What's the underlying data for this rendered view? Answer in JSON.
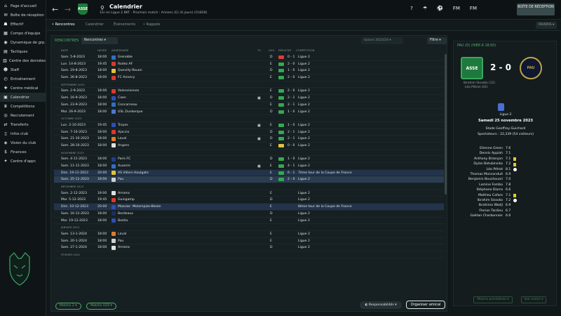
{
  "sidebar": {
    "items": [
      {
        "label": "Page d'accueil",
        "icon": "home-icon",
        "glyph": "⌂"
      },
      {
        "label": "Boîte de réception",
        "icon": "inbox-icon",
        "glyph": "✉"
      },
      {
        "label": "Effectif",
        "icon": "squad-icon",
        "glyph": "☗"
      },
      {
        "label": "Compo d'équipe",
        "icon": "tactics-board-icon",
        "glyph": "▦"
      },
      {
        "label": "Dynamique de grp.",
        "icon": "group-dynamics-icon",
        "glyph": "◉"
      },
      {
        "label": "Tactiques",
        "icon": "tactics-icon",
        "glyph": "▤"
      },
      {
        "label": "Centre des données",
        "icon": "data-icon",
        "glyph": "▥"
      },
      {
        "label": "Staff",
        "icon": "staff-icon",
        "glyph": "☻"
      },
      {
        "label": "Entraînement",
        "icon": "training-icon",
        "glyph": "◴"
      },
      {
        "label": "Centre médical",
        "icon": "medical-icon",
        "glyph": "✚"
      },
      {
        "label": "Calendrier",
        "icon": "calendar-icon",
        "glyph": "▣"
      },
      {
        "label": "Compétitions",
        "icon": "trophy-icon",
        "glyph": "♛"
      },
      {
        "label": "Recrutement",
        "icon": "scouting-icon",
        "glyph": "◎"
      },
      {
        "label": "Transferts",
        "icon": "transfers-icon",
        "glyph": "⇄"
      },
      {
        "label": "Infos club",
        "icon": "club-info-icon",
        "glyph": "▯"
      },
      {
        "label": "Vision du club",
        "icon": "club-vision-icon",
        "glyph": "◈"
      },
      {
        "label": "Finances",
        "icon": "finances-icon",
        "glyph": "$"
      },
      {
        "label": "Centre d'appr.",
        "icon": "academy-icon",
        "glyph": "✦"
      }
    ],
    "active_index": 10
  },
  "topbar": {
    "title": "Calendrier",
    "subtitle": "1er en Ligue 2 BKT · Prochain match : Amiens (E) (4 jours) (Ch828)",
    "badge": "ASSE",
    "icons": [
      "?",
      "☂",
      "⚽",
      "FM",
      "FM"
    ],
    "inbox_label": "BOÎTE DE RÉCEPTION"
  },
  "subtabs": {
    "items": [
      "• Rencontres",
      "Calendrier",
      "Événements",
      "• Rappels"
    ],
    "favorites": "FAVORIS ▾"
  },
  "main": {
    "section_label": "RENCONTRES",
    "dropdown": "Rencontres ▾",
    "season": "Saison 2023/24 ▾",
    "filter": "Filtre ▾",
    "columns": [
      "DATE",
      "HEURE",
      "ADVERSAIRE",
      "TV",
      "LIEU",
      "RÉSULTAT",
      "COMPÉTITION"
    ],
    "rows": [
      {
        "type": "match",
        "date": "Sam. 5-8-2023",
        "time": "18:00",
        "opp": "Grenoble",
        "crest": "#2f6fc4",
        "tv": "",
        "venue": "D",
        "res": "#e23a3a",
        "score": "0 - 1",
        "comp": "Ligue 2"
      },
      {
        "type": "match",
        "date": "Lun. 14-8-2023",
        "time": "19:45",
        "opp": "Rodez AF",
        "crest": "#d9382f",
        "tv": "",
        "venue": "E",
        "res": "#34a853",
        "score": "2 - 0",
        "comp": "Ligue 2"
      },
      {
        "type": "match",
        "date": "Sam. 19-8-2023",
        "time": "18:00",
        "opp": "Quevilly-Rouen",
        "crest": "#e2c23a",
        "tv": "",
        "venue": "D",
        "res": "#34a853",
        "score": "1 - 0",
        "comp": "Ligue 2"
      },
      {
        "type": "match",
        "date": "Sam. 26-8-2023",
        "time": "18:00",
        "opp": "FC Annecy",
        "crest": "#d93a2f",
        "tv": "",
        "venue": "E",
        "res": "#34a853",
        "score": "2 - 0",
        "comp": "Ligue 2"
      },
      {
        "type": "header",
        "label": "SEPTEMBRE 2023"
      },
      {
        "type": "match",
        "date": "Sam. 2-9-2023",
        "time": "18:00",
        "opp": "Valenciennes",
        "crest": "#d93a2f",
        "tv": "",
        "venue": "E",
        "res": "#34a853",
        "score": "2 - 0",
        "comp": "Ligue 2"
      },
      {
        "type": "match",
        "date": "Sam. 16-9-2023",
        "time": "18:00",
        "opp": "Caen",
        "crest": "#2f4fb4",
        "tv": "▣",
        "venue": "D",
        "res": "#34a853",
        "score": "2 - 1",
        "comp": "Ligue 2"
      },
      {
        "type": "match",
        "date": "Sam. 23-9-2023",
        "time": "18:00",
        "opp": "Concarneau",
        "crest": "#2f6fc4",
        "tv": "",
        "venue": "E",
        "res": "#34a853",
        "score": "2 - 1",
        "comp": "Ligue 2"
      },
      {
        "type": "match",
        "date": "Mar. 26-9-2023",
        "time": "18:00",
        "opp": "USL Dunkerque",
        "crest": "#4a7ad0",
        "tv": "",
        "venue": "D",
        "res": "#34a853",
        "score": "1 - 0",
        "comp": "Ligue 2"
      },
      {
        "type": "header",
        "label": "OCTOBRE 2023"
      },
      {
        "type": "match",
        "date": "Lun. 2-10-2023",
        "time": "19:45",
        "opp": "Troyes",
        "crest": "#2f4fb4",
        "tv": "▣",
        "venue": "E",
        "res": "#34a853",
        "score": "1 - 0",
        "comp": "Ligue 2"
      },
      {
        "type": "match",
        "date": "Sam. 7-10-2023",
        "time": "18:00",
        "opp": "Ajaccio",
        "crest": "#d93a2f",
        "tv": "",
        "venue": "D",
        "res": "#34a853",
        "score": "2 - 1",
        "comp": "Ligue 2"
      },
      {
        "type": "match",
        "date": "Sam. 21-10-2023",
        "time": "18:00",
        "opp": "Laval",
        "crest": "#e27a2a",
        "tv": "▣",
        "venue": "D",
        "res": "#34a853",
        "score": "2 - 1",
        "comp": "Ligue 2"
      },
      {
        "type": "match",
        "date": "Sam. 28-10-2023",
        "time": "18:00",
        "opp": "Angers",
        "crest": "#e0e0e0",
        "tv": "",
        "venue": "E",
        "res": "#e2c23a",
        "score": "0 - 0",
        "comp": "Ligue 2"
      },
      {
        "type": "header",
        "label": "NOVEMBRE 2023"
      },
      {
        "type": "match",
        "date": "Sam. 4-11-2023",
        "time": "18:00",
        "opp": "Paris FC",
        "crest": "#1f3f8a",
        "tv": "",
        "venue": "D",
        "res": "#34a853",
        "score": "1 - 0",
        "comp": "Ligue 2"
      },
      {
        "type": "match",
        "date": "Sam. 11-11-2023",
        "time": "18:00",
        "opp": "Auxerre",
        "crest": "#2f6fc4",
        "tv": "▣",
        "venue": "E",
        "res": "#34a853",
        "score": "4 - 1",
        "comp": "Ligue 2"
      },
      {
        "type": "match",
        "date": "Dim. 19-11-2023",
        "time": "20:00",
        "opp": "AS Villers Houlgate",
        "crest": "#e2c23a",
        "tv": "",
        "venue": "E",
        "res": "#34a853",
        "score": "6 - 1",
        "comp": "7ème tour de la Coupe de France",
        "sel": "sel2"
      },
      {
        "type": "match",
        "date": "Sam. 25-11-2023",
        "time": "18:00",
        "opp": "Pau",
        "crest": "#d0d0d0",
        "tv": "",
        "venue": "D",
        "res": "#34a853",
        "score": "2 - 0",
        "comp": "Ligue 2",
        "sel": "sel"
      },
      {
        "type": "header",
        "label": "DÉCEMBRE 2023"
      },
      {
        "type": "match",
        "date": "Sam. 2-12-2023",
        "time": "18:00",
        "opp": "Amiens",
        "crest": "#e0e0e0",
        "tv": "",
        "venue": "E",
        "res": "",
        "score": "",
        "comp": "Ligue 2"
      },
      {
        "type": "match",
        "date": "Mar. 5-12-2023",
        "time": "19:45",
        "opp": "Guingamp",
        "crest": "#d93a2f",
        "tv": "",
        "venue": "D",
        "res": "",
        "score": "",
        "comp": "Ligue 2"
      },
      {
        "type": "match",
        "date": "Dim. 10-12-2023",
        "time": "20:00",
        "opp": "Massiac -Molompize-Blesle",
        "crest": "#2f4fb4",
        "tv": "",
        "venue": "E",
        "res": "",
        "score": "",
        "comp": "8ème tour de la Coupe de France",
        "sel": "sel2"
      },
      {
        "type": "match",
        "date": "Sam. 16-12-2023",
        "time": "18:00",
        "opp": "Bordeaux",
        "crest": "#1f2f5a",
        "tv": "",
        "venue": "D",
        "res": "",
        "score": "",
        "comp": "Ligue 2"
      },
      {
        "type": "match",
        "date": "Mar. 19-12-2023",
        "time": "18:00",
        "opp": "Bastia",
        "crest": "#2f4fb4",
        "tv": "",
        "venue": "E",
        "res": "",
        "score": "",
        "comp": "Ligue 2"
      },
      {
        "type": "header",
        "label": "JANVIER 2024"
      },
      {
        "type": "match",
        "date": "Sam. 13-1-2024",
        "time": "18:00",
        "opp": "Laval",
        "crest": "#e27a2a",
        "tv": "",
        "venue": "E",
        "res": "",
        "score": "",
        "comp": "Ligue 2"
      },
      {
        "type": "match",
        "date": "Sam. 20-1-2024",
        "time": "18:00",
        "opp": "Pau",
        "crest": "#d0d0d0",
        "tv": "",
        "venue": "E",
        "res": "",
        "score": "",
        "comp": "Ligue 2"
      },
      {
        "type": "match",
        "date": "Sam. 27-1-2024",
        "time": "18:00",
        "opp": "Amiens",
        "crest": "#e0e0e0",
        "tv": "",
        "venue": "D",
        "res": "",
        "score": "",
        "comp": "Ligue 2"
      },
      {
        "type": "header",
        "label": "FÉVRIER 2024"
      }
    ],
    "btn_matches": "Matchs 2 ▾",
    "btn_u19": "Matchs U19 ▾",
    "btn_resp": "◐ Responsabilités ▾",
    "btn_friendly": "Organiser amical"
  },
  "result_panel": {
    "header": "PAU (D) (HIER À 18:00)",
    "home_badge": "ASSE",
    "away_badge": "PAU",
    "score": "2 - 0",
    "scorers": [
      "Ibrahim Sissoko (12)",
      "Léo Pétrot (41)"
    ],
    "competition": "Ligue 2",
    "date": "Samedi 25 novembre 2023",
    "stadium": "Stade Geoffroy-Guichard",
    "spectators": "Spectateurs : 22,339 (54 visiteurs)",
    "players": [
      {
        "name": "Etienne Green",
        "rating": "7.6",
        "ev": ""
      },
      {
        "name": "Dennis Appiah",
        "rating": "7.1",
        "ev": ""
      },
      {
        "name": "Anthony Briançon",
        "rating": "7.1",
        "ev": "card"
      },
      {
        "name": "Dylan Batubinsika",
        "rating": "7.2",
        "ev": "card"
      },
      {
        "name": "Léo Pétrot",
        "rating": "8.1",
        "ev": "goal"
      },
      {
        "name": "Thomas Monconduit",
        "rating": "6.9",
        "ev": ""
      },
      {
        "name": "Benjamin Bouchouari",
        "rating": "7.0",
        "ev": ""
      },
      {
        "name": "Lamine Fomba",
        "rating": "7.8",
        "ev": ""
      },
      {
        "name": "Stéphane Diarra",
        "rating": "6.6",
        "ev": ""
      },
      {
        "name": "Mathieu Cafaro",
        "rating": "7.1",
        "ev": "card"
      },
      {
        "name": "Ibrahim Sissoko",
        "rating": "7.2",
        "ev": "goal"
      },
      {
        "name": "Ibrahima Wadji",
        "rating": "6.9",
        "ev": ""
      },
      {
        "name": "Florian Tardieu",
        "rating": "6.7",
        "ev": ""
      },
      {
        "name": "Gaëtan Charbonnier",
        "rating": "6.6",
        "ev": ""
      }
    ],
    "btn_prev": "Matchs précédents ▾",
    "btn_view": "Voir match ▾"
  }
}
